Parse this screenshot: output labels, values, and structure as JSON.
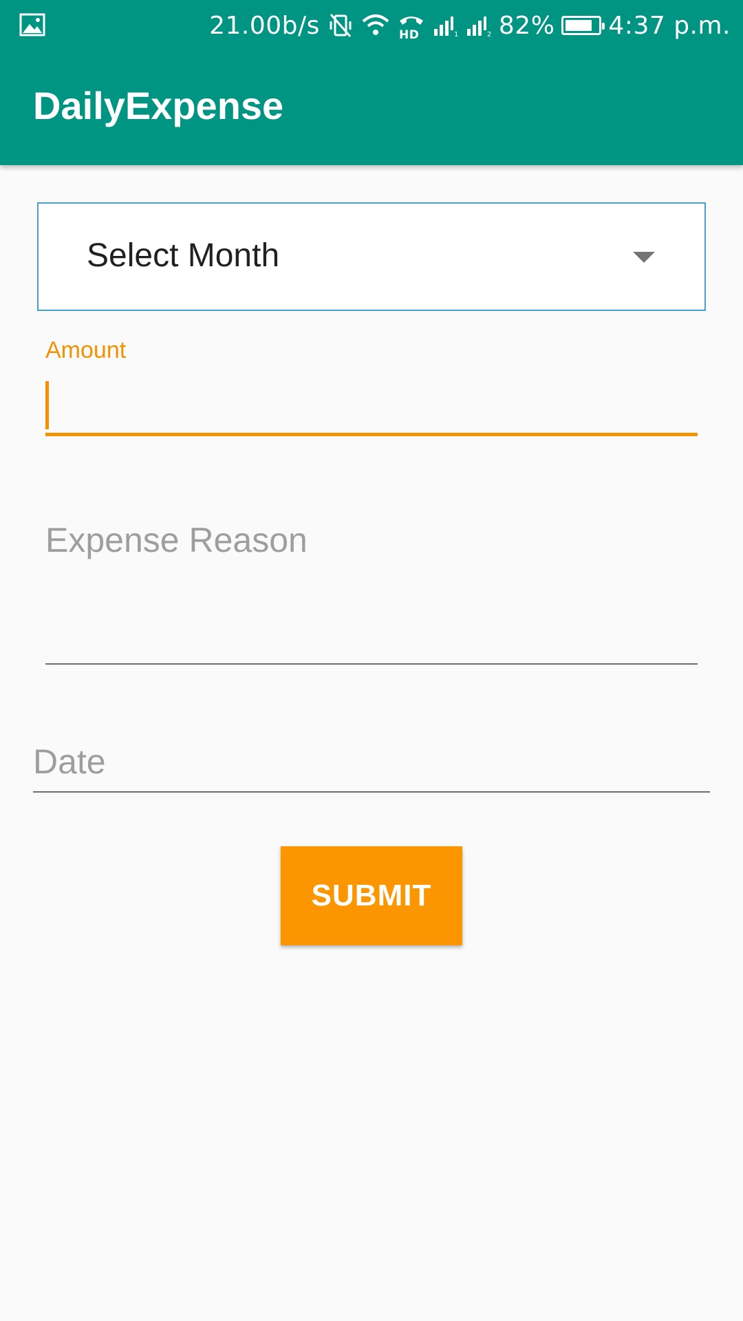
{
  "status_bar": {
    "network_speed": "21.00b/s",
    "battery_percent": "82%",
    "battery_level": 0.82,
    "time": "4:37 p.m.",
    "hd_label": "HD",
    "icons": [
      "gallery-icon",
      "vibrate-off-icon",
      "wifi-icon",
      "hd-call-icon",
      "signal-1-icon",
      "signal-2-icon",
      "battery-icon"
    ]
  },
  "app_bar": {
    "title": "DailyExpense"
  },
  "form": {
    "month_spinner": {
      "selected": "Select Month"
    },
    "amount": {
      "label": "Amount",
      "value": ""
    },
    "expense_reason": {
      "placeholder": "Expense Reason",
      "value": ""
    },
    "date": {
      "placeholder": "Date",
      "value": ""
    },
    "submit_label": "SUBMIT"
  },
  "colors": {
    "primary": "#009483",
    "accent": "#fb9600",
    "spinner_border": "#4a9ec9",
    "hint_text": "#9e9e9e",
    "background": "#fafafa"
  }
}
